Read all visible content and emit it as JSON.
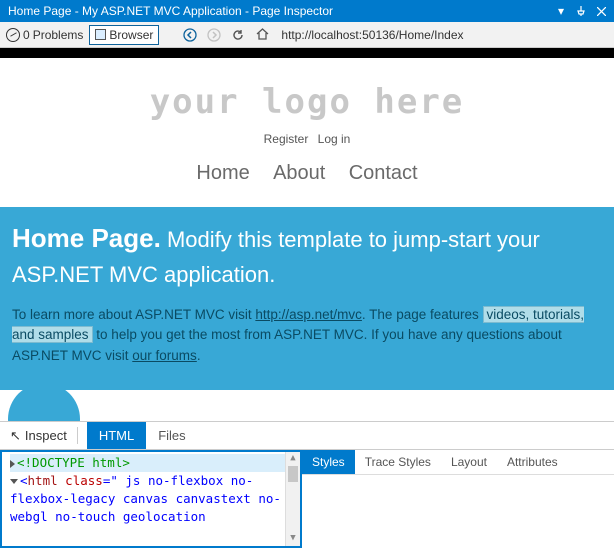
{
  "window": {
    "title": "Home Page - My ASP.NET MVC Application - Page Inspector"
  },
  "toolbar": {
    "problems_count": "0",
    "problems_label": "Problems",
    "browser_label": "Browser",
    "url": "http://localhost:50136/Home/Index"
  },
  "page": {
    "logo": "your logo here",
    "register": "Register",
    "login": "Log in",
    "nav": {
      "home": "Home",
      "about": "About",
      "contact": "Contact"
    },
    "hero_title": "Home Page.",
    "hero_sub": " Modify this template to jump-start your ASP.NET MVC application.",
    "desc1a": "To learn more about ASP.NET MVC visit ",
    "desc1_link": "http://asp.net/mvc",
    "desc1b": ". The page features ",
    "desc1_hl": "videos, tutorials, and samples",
    "desc1c": " to help you get the most from ASP.NET MVC. If you have any questions about ASP.NET MVC visit ",
    "desc1_forums": "our forums",
    "desc1d": "."
  },
  "inspector": {
    "inspect_label": "Inspect",
    "tab_html": "HTML",
    "tab_files": "Files",
    "code_line1": "<!DOCTYPE html>",
    "code_htmlopen": "html",
    "code_classattr": "class",
    "code_classval": "\" js no-flexbox no-flexbox-legacy canvas canvastext no-webgl no-touch geolocation",
    "right_tabs": {
      "styles": "Styles",
      "trace": "Trace Styles",
      "layout": "Layout",
      "attrs": "Attributes"
    }
  }
}
